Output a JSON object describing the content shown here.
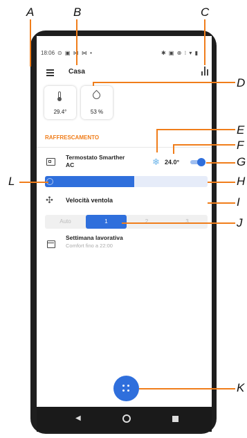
{
  "callouts": [
    "A",
    "B",
    "C",
    "D",
    "E",
    "F",
    "G",
    "H",
    "I",
    "J",
    "K",
    "L"
  ],
  "status_bar": {
    "time": "18:06",
    "left_icons": "⊙ ▣ ⋈ ⋈ •",
    "right_icons": "✱ ▣ ⊕ ⁝ ▾ ▮"
  },
  "header": {
    "title": "Casa"
  },
  "sensors": [
    {
      "icon": "thermometer-icon",
      "value": "29.4°"
    },
    {
      "icon": "humidity-drop-icon",
      "value": "53 %"
    }
  ],
  "section": {
    "title": "RAFFRESCAMENTO"
  },
  "thermostat": {
    "name_line1": "Termostato Smarther",
    "name_line2": "AC",
    "mode_icon": "snowflake-icon",
    "setpoint": "24.0°",
    "enabled": true
  },
  "slider": {
    "level": 0.55
  },
  "fan": {
    "label": "Velocità ventola",
    "options": [
      "Auto",
      "1",
      "2",
      "3"
    ],
    "selected": "1"
  },
  "schedule": {
    "title": "Settimana lavorativa",
    "subtitle": "Comfort fino a 22:00"
  },
  "colors": {
    "accent": "#2f6fdc",
    "orange": "#f07d1a",
    "snow": "#6fb6ea"
  }
}
